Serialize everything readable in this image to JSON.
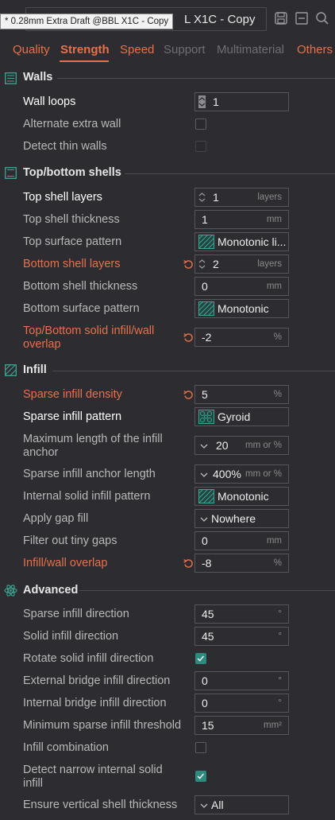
{
  "header": {
    "preset_name_tail": "L X1C - Copy",
    "tooltip": "* 0.28mm Extra Draft @BBL X1C - Copy"
  },
  "tabs": [
    {
      "label": "Quality",
      "state": "normal"
    },
    {
      "label": "Strength",
      "state": "active"
    },
    {
      "label": "Speed",
      "state": "normal"
    },
    {
      "label": "Support",
      "state": "disabled"
    },
    {
      "label": "Multimaterial",
      "state": "disabled"
    },
    {
      "label": "Others",
      "state": "normal"
    }
  ],
  "sections": {
    "walls": {
      "title": "Walls",
      "wall_loops": {
        "label": "Wall loops",
        "value": "1"
      },
      "alternate_extra_wall": {
        "label": "Alternate extra wall"
      },
      "detect_thin_walls": {
        "label": "Detect thin walls"
      }
    },
    "top_bottom": {
      "title": "Top/bottom shells",
      "top_shell_layers": {
        "label": "Top shell layers",
        "value": "1",
        "unit": "layers"
      },
      "top_shell_thickness": {
        "label": "Top shell thickness",
        "value": "1",
        "unit": "mm"
      },
      "top_surface_pattern": {
        "label": "Top surface pattern",
        "value": "Monotonic li..."
      },
      "bottom_shell_layers": {
        "label": "Bottom shell layers",
        "value": "2",
        "unit": "layers"
      },
      "bottom_shell_thickness": {
        "label": "Bottom shell thickness",
        "value": "0",
        "unit": "mm"
      },
      "bottom_surface_pattern": {
        "label": "Bottom surface pattern",
        "value": "Monotonic"
      },
      "solid_infill_overlap": {
        "label": "Top/Bottom solid infill/wall overlap",
        "value": "-2",
        "unit": "%"
      }
    },
    "infill": {
      "title": "Infill",
      "sparse_infill_density": {
        "label": "Sparse infill density",
        "value": "5",
        "unit": "%"
      },
      "sparse_infill_pattern": {
        "label": "Sparse infill pattern",
        "value": "Gyroid"
      },
      "max_anchor_length": {
        "label": "Maximum length of the infill anchor",
        "value": "20",
        "unit": "mm or %"
      },
      "anchor_length": {
        "label": "Sparse infill anchor length",
        "value": "400%",
        "unit": "mm or %"
      },
      "internal_solid_pattern": {
        "label": "Internal solid infill pattern",
        "value": "Monotonic"
      },
      "apply_gap_fill": {
        "label": "Apply gap fill",
        "value": "Nowhere"
      },
      "filter_tiny_gaps": {
        "label": "Filter out tiny gaps",
        "value": "0",
        "unit": "mm"
      },
      "infill_wall_overlap": {
        "label": "Infill/wall overlap",
        "value": "-8",
        "unit": "%"
      }
    },
    "advanced": {
      "title": "Advanced",
      "sparse_infill_direction": {
        "label": "Sparse infill direction",
        "value": "45",
        "unit": "°"
      },
      "solid_infill_direction": {
        "label": "Solid infill direction",
        "value": "45",
        "unit": "°"
      },
      "rotate_solid_infill": {
        "label": "Rotate solid infill direction",
        "checked": true
      },
      "external_bridge_direction": {
        "label": "External bridge infill direction",
        "value": "0",
        "unit": "°"
      },
      "internal_bridge_direction": {
        "label": "Internal bridge infill direction",
        "value": "0",
        "unit": "°"
      },
      "min_sparse_threshold": {
        "label": "Minimum sparse infill threshold",
        "value": "15",
        "unit": "mm²"
      },
      "infill_combination": {
        "label": "Infill combination",
        "checked": false
      },
      "detect_narrow_solid": {
        "label": "Detect narrow internal solid infill",
        "checked": true
      },
      "ensure_vertical_shell": {
        "label": "Ensure vertical shell thickness",
        "value": "All"
      }
    }
  },
  "colors": {
    "background": "#2d2d31",
    "accent": "#e8704a",
    "teal": "#2f8a7e",
    "field_border": "#55555b"
  }
}
